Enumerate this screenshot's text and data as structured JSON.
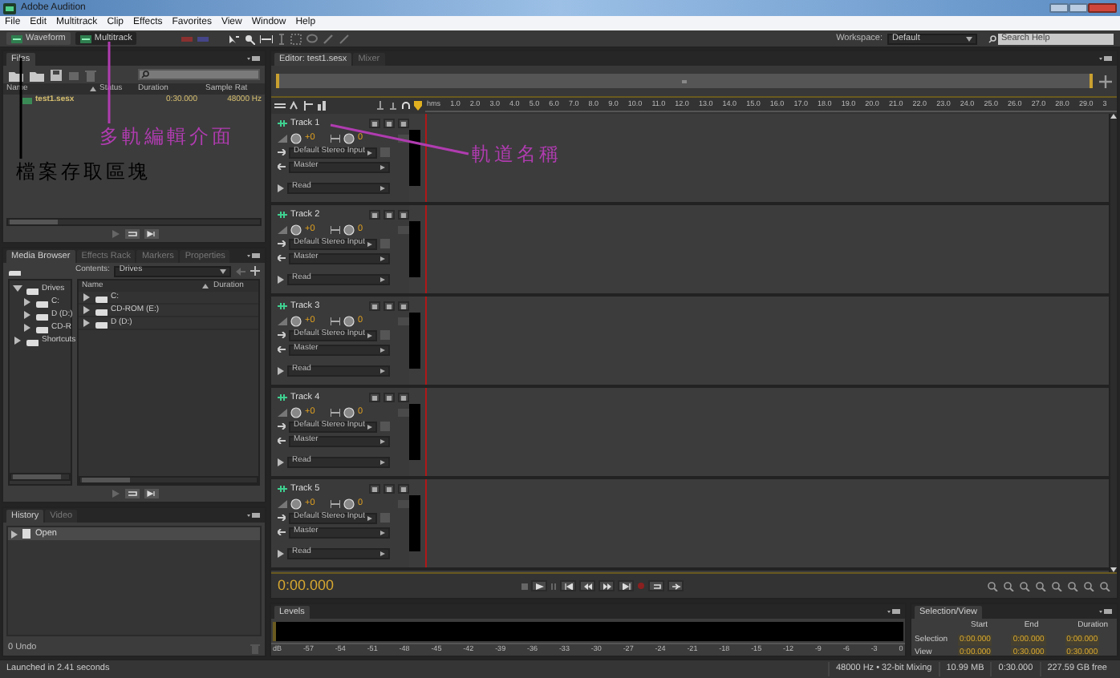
{
  "window": {
    "title": "Adobe Audition"
  },
  "menu": [
    "File",
    "Edit",
    "Multitrack",
    "Clip",
    "Effects",
    "Favorites",
    "View",
    "Window",
    "Help"
  ],
  "toolbar": {
    "modes": [
      {
        "label": "Waveform",
        "selected": false
      },
      {
        "label": "Multitrack",
        "selected": true
      }
    ],
    "workspace_label": "Workspace:",
    "workspace": "Default",
    "search": {
      "placeholder": "Search Help"
    }
  },
  "files_panel": {
    "tabs": [
      {
        "label": "Files",
        "selected": true
      }
    ],
    "columns": [
      "Name",
      "Status",
      "Duration",
      "Sample Rat"
    ],
    "rows": [
      {
        "name": "test1.sesx",
        "duration": "0:30.000",
        "sample_rate": "48000 Hz"
      }
    ]
  },
  "media_panel": {
    "tabs": [
      {
        "label": "Media Browser",
        "selected": true
      },
      {
        "label": "Effects Rack",
        "selected": false
      },
      {
        "label": "Markers",
        "selected": false
      },
      {
        "label": "Properties",
        "selected": false
      }
    ],
    "contents_label": "Contents:",
    "contents": "Drives",
    "tree": [
      {
        "label": "Drives",
        "expanded": true,
        "children": [
          {
            "label": "C:",
            "expanded": false
          },
          {
            "label": "D (D:)",
            "expanded": false
          },
          {
            "label": "CD-R",
            "expanded": false
          }
        ]
      },
      {
        "label": "Shortcuts",
        "expanded": false
      }
    ],
    "columns": [
      "Name",
      "Duration"
    ],
    "rows": [
      "C:",
      "CD-ROM (E:)",
      "D (D:)"
    ]
  },
  "history_panel": {
    "tabs": [
      {
        "label": "History",
        "selected": true
      },
      {
        "label": "Video",
        "selected": false
      }
    ],
    "items": [
      "Open"
    ],
    "undo_count": "0 Undo"
  },
  "editor": {
    "tabs": [
      {
        "label": "Editor: test1.sesx",
        "selected": true
      },
      {
        "label": "Mixer",
        "selected": false
      }
    ],
    "ruler": [
      "hms",
      "1.0",
      "2.0",
      "3.0",
      "4.0",
      "5.0",
      "6.0",
      "7.0",
      "8.0",
      "9.0",
      "10.0",
      "11.0",
      "12.0",
      "13.0",
      "14.0",
      "15.0",
      "16.0",
      "17.0",
      "18.0",
      "19.0",
      "20.0",
      "21.0",
      "22.0",
      "23.0",
      "24.0",
      "25.0",
      "26.0",
      "27.0",
      "28.0",
      "29.0",
      "3"
    ],
    "tracks": [
      {
        "name": "Track 1",
        "volume": "+0",
        "pan": "0",
        "input": "Default Stereo Input",
        "output": "Master",
        "automation": "Read"
      },
      {
        "name": "Track 2",
        "volume": "+0",
        "pan": "0",
        "input": "Default Stereo Input",
        "output": "Master",
        "automation": "Read"
      },
      {
        "name": "Track 3",
        "volume": "+0",
        "pan": "0",
        "input": "Default Stereo Input",
        "output": "Master",
        "automation": "Read"
      },
      {
        "name": "Track 4",
        "volume": "+0",
        "pan": "0",
        "input": "Default Stereo Input",
        "output": "Master",
        "automation": "Read"
      },
      {
        "name": "Track 5",
        "volume": "+0",
        "pan": "0",
        "input": "Default Stereo Input",
        "output": "Master",
        "automation": "Read"
      }
    ],
    "time": "0:00.000"
  },
  "levels_panel": {
    "tabs": [
      {
        "label": "Levels",
        "selected": true
      }
    ],
    "scale": [
      "dB",
      "-57",
      "-54",
      "-51",
      "-48",
      "-45",
      "-42",
      "-39",
      "-36",
      "-33",
      "-30",
      "-27",
      "-24",
      "-21",
      "-18",
      "-15",
      "-12",
      "-9",
      "-6",
      "-3",
      "0"
    ]
  },
  "selection_panel": {
    "tabs": [
      {
        "label": "Selection/View",
        "selected": true
      }
    ],
    "columns": [
      "Start",
      "End",
      "Duration"
    ],
    "rows": [
      {
        "label": "Selection",
        "values": [
          "0:00.000",
          "0:00.000",
          "0:00.000"
        ]
      },
      {
        "label": "View",
        "values": [
          "0:00.000",
          "0:30.000",
          "0:30.000"
        ]
      }
    ]
  },
  "status_bar": {
    "message": "Launched in 2.41 seconds",
    "items": [
      "48000 Hz • 32-bit Mixing",
      "10.99 MB",
      "0:30.000",
      "227.59 GB free"
    ]
  },
  "annotations": [
    {
      "kind": "mode",
      "text": "多軌編輯介面",
      "color": "#b03cb0"
    },
    {
      "kind": "files",
      "text": "檔案存取區塊",
      "color": "#000000"
    },
    {
      "kind": "track",
      "text": "軌道名稱",
      "color": "#b03cb0"
    }
  ]
}
